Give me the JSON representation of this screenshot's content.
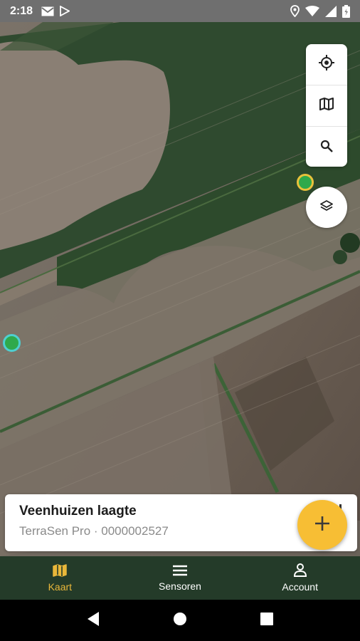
{
  "status_bar": {
    "time": "2:18",
    "left_icons": [
      "mail-icon",
      "play-store-icon"
    ],
    "right_icons": [
      "location-icon",
      "wifi-icon",
      "signal-icon",
      "battery-icon"
    ]
  },
  "map": {
    "markers": [
      {
        "name": "sensor-marker-yellow",
        "fill": "#2fa94b",
        "ring": "#e9c23b"
      },
      {
        "name": "sensor-marker-teal",
        "fill": "#2fa94b",
        "ring": "#4ecfd0"
      }
    ],
    "controls": [
      "crosshair-icon",
      "map-icon",
      "search-icon"
    ],
    "layers_control": "layers-icon"
  },
  "card": {
    "title": "Veenhuizen laagte",
    "subtitle": "TerraSen Pro · 0000002527"
  },
  "fab": {
    "icon": "plus-icon",
    "color": "#f7be34"
  },
  "bottom_nav": {
    "items": [
      {
        "label": "Kaart",
        "icon": "map-icon",
        "active": true
      },
      {
        "label": "Sensoren",
        "icon": "menu-icon",
        "active": false
      },
      {
        "label": "Account",
        "icon": "person-icon",
        "active": false
      }
    ],
    "active_color": "#e9b73a",
    "background": "#243b29"
  },
  "system_nav": [
    "back-icon",
    "home-icon",
    "recents-icon"
  ]
}
